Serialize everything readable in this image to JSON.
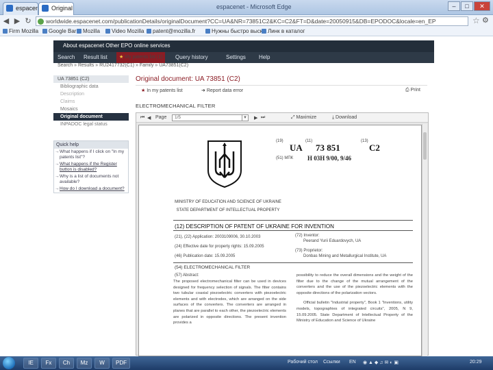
{
  "browser": {
    "tab1": "espacenet",
    "tab2": "Original docum",
    "window_title": "espacenet - Microsoft Edge",
    "url": "worldwide.espacenet.com/publicationDetails/originalDocument?CC=UA&NR=73851C2&KC=C2&FT=D&date=20050915&DB=EPODOC&locale=en_EP",
    "bookmarks": [
      "Firm Mozilla",
      "Google Bar",
      "Mozilla",
      "Video Mozilla",
      "patent@mozilla.fr",
      "Нужны быстро выск...",
      "Линк в каталог"
    ]
  },
  "nav": {
    "brand": "About espacenet   Other EPO online services",
    "items": [
      "Search",
      "Result list",
      "My patents list (1)",
      "Query history",
      "Settings",
      "Help"
    ],
    "breadcrumb": "Search  »  Results  »  RU2417732(C1)  »  Family  »  UA73851(C2)"
  },
  "sidebar": {
    "header": "UA 73851  (C2)",
    "items": [
      "Bibliographic data",
      "Description",
      "Claims",
      "Mosaics",
      "Original document",
      "INPADOC legal status"
    ],
    "active_index": 4
  },
  "quickhelp": {
    "title": "Quick help",
    "items": [
      "What happens if I click on \"In my patents list\"?",
      "What happens if the Register button is disabled?",
      "Why is a list of documents not available?",
      "How do I download a document?"
    ]
  },
  "document": {
    "title": "Original document: UA 73851  (C2)",
    "actions": [
      "In my patents list",
      "Report data error",
      "Print"
    ],
    "section": "ELECTROMECHANICAL FILTER",
    "viewer": {
      "page_label": "Page",
      "page_value": "1/5",
      "maximize": "Maximize",
      "download": "Download"
    }
  },
  "patent": {
    "code19": "(19)",
    "country": "UA",
    "code11": "(11)",
    "number": "73 851",
    "code13": "(13)",
    "kind": "C2",
    "code51": "(51) МПК",
    "ipc": "H 03H 9/00, 9/46",
    "ministry": "MINISTRY OF EDUCATION AND SCIENCE OF UKRAINE",
    "department": "STATE DEPARTMENT OF INTELLECTUAL PROPERTY",
    "heading": "(12) DESCRIPTION OF PATENT OF UKRAINE FOR INVENTION",
    "f21": "(21), (22) Application: 2003109006, 30.10.2003",
    "f24": "(24) Effective date for property rights: 15.09.2005",
    "f46": "(46) Publication date: 15.09.2005",
    "f72": "(72) Inventor:",
    "inventor": "Peerand Yurii Eduardovych, UA",
    "f73": "(73) Proprietor:",
    "proprietor": "Donbas Mining and Metallurgical Institute, UA",
    "f54": "(54) ELECTROMECHANICAL FILTER",
    "f57": "(57) Abstract:",
    "abstract_left": "The proposed electromechanical filter can be used in devices designed for frequency selection of signals. The filter contains two tubular coaxial piezoelectric converters with piezoelectric elements and with electrodes, which are arranged on the side surfaces of the converters. The converters are arranged in planes that are parallel to each other, the piezoelectric elements are polarized in opposite directions. The present invention provides a",
    "abstract_right": "possibility to reduce the overall dimensions and the weight of the filter due to the change of the mutual arrangement of the converters and the use of the piezoelectric elements with the opposite directions of the polarization vectors.",
    "bulletin": "Official bulletin \"Industrial property\", Book 1 \"Inventions, utility models, topographies of integrated circuits\", 2005, N 9, 15.09.2005. State Department of Intellectual Property of the Ministry of Education and Science of Ukraine"
  },
  "taskbar": {
    "items": [
      "IE",
      "Fx",
      "Ch",
      "Mz",
      "PDF",
      "W"
    ],
    "tray1": "Рабочий стол",
    "tray2": "Ссылки",
    "lang": "EN",
    "clock": "20:29"
  }
}
